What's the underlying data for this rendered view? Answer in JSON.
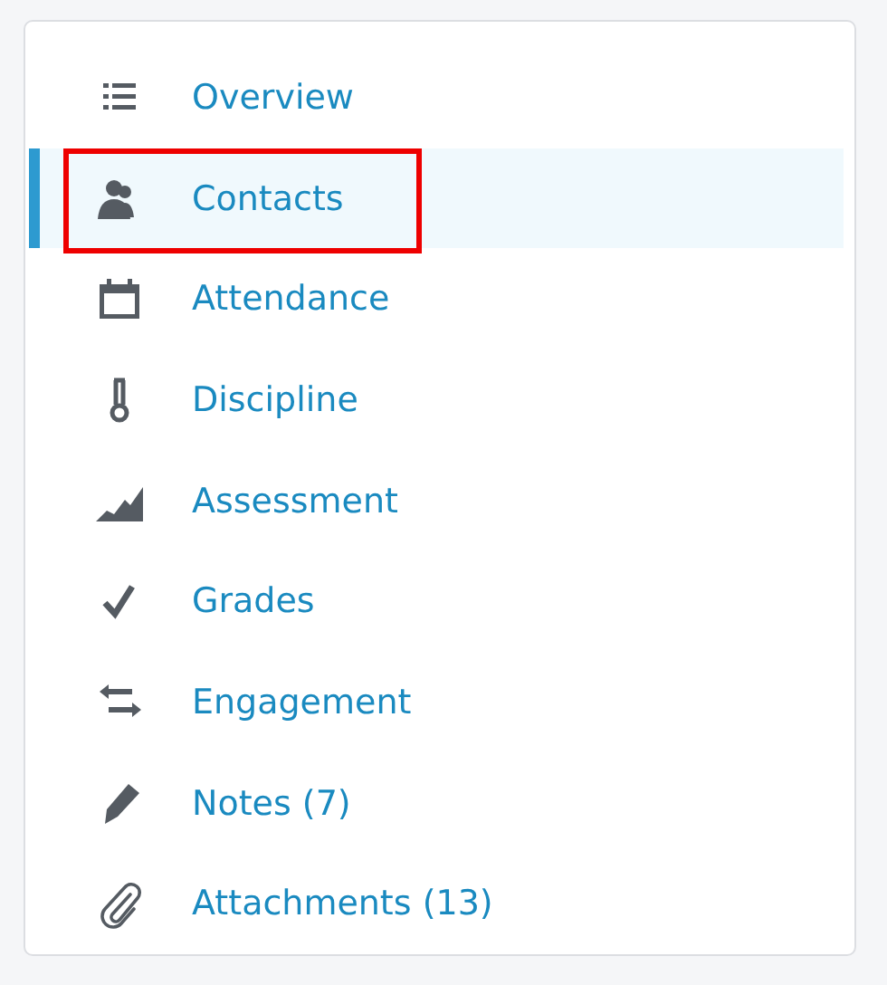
{
  "nav": {
    "items": [
      {
        "kind": "list",
        "label": "Overview",
        "selected": false,
        "highlighted": false
      },
      {
        "kind": "contacts",
        "label": "Contacts",
        "selected": true,
        "highlighted": true
      },
      {
        "kind": "calendar",
        "label": "Attendance",
        "selected": false,
        "highlighted": false
      },
      {
        "kind": "thermometer",
        "label": "Discipline",
        "selected": false,
        "highlighted": false
      },
      {
        "kind": "area",
        "label": "Assessment",
        "selected": false,
        "highlighted": false
      },
      {
        "kind": "check",
        "label": "Grades",
        "selected": false,
        "highlighted": false
      },
      {
        "kind": "arrows",
        "label": "Engagement",
        "selected": false,
        "highlighted": false
      },
      {
        "kind": "pencil",
        "label": "Notes (7)",
        "selected": false,
        "highlighted": false
      },
      {
        "kind": "paperclip",
        "label": "Attachments (13)",
        "selected": false,
        "highlighted": false
      }
    ]
  }
}
